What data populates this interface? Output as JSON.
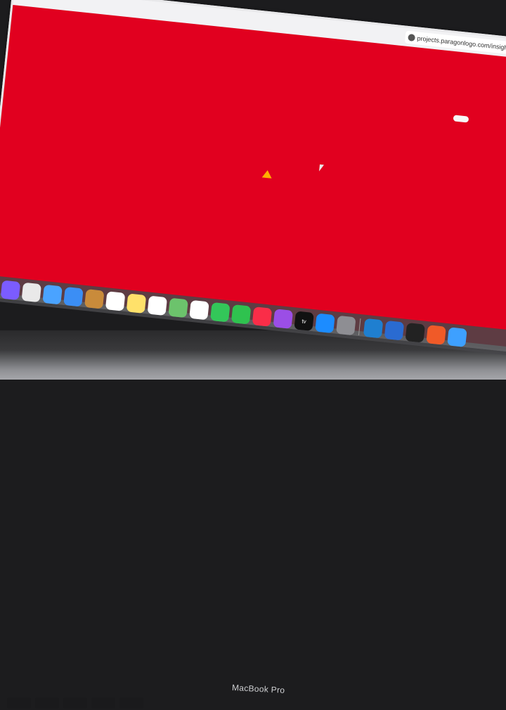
{
  "browser": {
    "url": "projects.paragonlogo.com/insigh"
  },
  "page": {
    "background_color": "#e1001f"
  },
  "dock": {
    "items": [
      {
        "icon": "finder-icon",
        "color": "#5aa7ff"
      },
      {
        "icon": "siri-icon",
        "color": "#7b5cff"
      },
      {
        "icon": "launchpad-icon",
        "color": "#e9e9e9"
      },
      {
        "icon": "safari-icon",
        "color": "#4aa3ff"
      },
      {
        "icon": "mail-icon",
        "color": "#3b8ef5"
      },
      {
        "icon": "contacts-icon",
        "color": "#c98b3b"
      },
      {
        "icon": "calendar-icon",
        "color": "#ffffff"
      },
      {
        "icon": "notes-icon",
        "color": "#ffe16a"
      },
      {
        "icon": "reminders-icon",
        "color": "#ffffff"
      },
      {
        "icon": "maps-icon",
        "color": "#6cc36c"
      },
      {
        "icon": "photos-icon",
        "color": "#ffffff"
      },
      {
        "icon": "messages-icon",
        "color": "#33c759"
      },
      {
        "icon": "facetime-icon",
        "color": "#2fc24f"
      },
      {
        "icon": "music-icon",
        "color": "#fa2d48"
      },
      {
        "icon": "podcasts-icon",
        "color": "#9b4ee6"
      },
      {
        "icon": "apple-tv-icon",
        "color": "#111111",
        "label": "tv"
      },
      {
        "icon": "app-store-icon",
        "color": "#1c8cff"
      },
      {
        "icon": "system-preferences-icon",
        "color": "#8e8e93"
      }
    ],
    "apps_after_separator": [
      {
        "icon": "vscode-icon",
        "color": "#1f7fd0"
      },
      {
        "icon": "xcode-icon",
        "color": "#2a6bd1"
      },
      {
        "icon": "terminal-icon",
        "color": "#222222"
      },
      {
        "icon": "app-icon-orange",
        "color": "#f05a28"
      },
      {
        "icon": "folder-icon",
        "color": "#3ea0ff"
      }
    ]
  },
  "laptop": {
    "brand": "MacBook Pro"
  }
}
